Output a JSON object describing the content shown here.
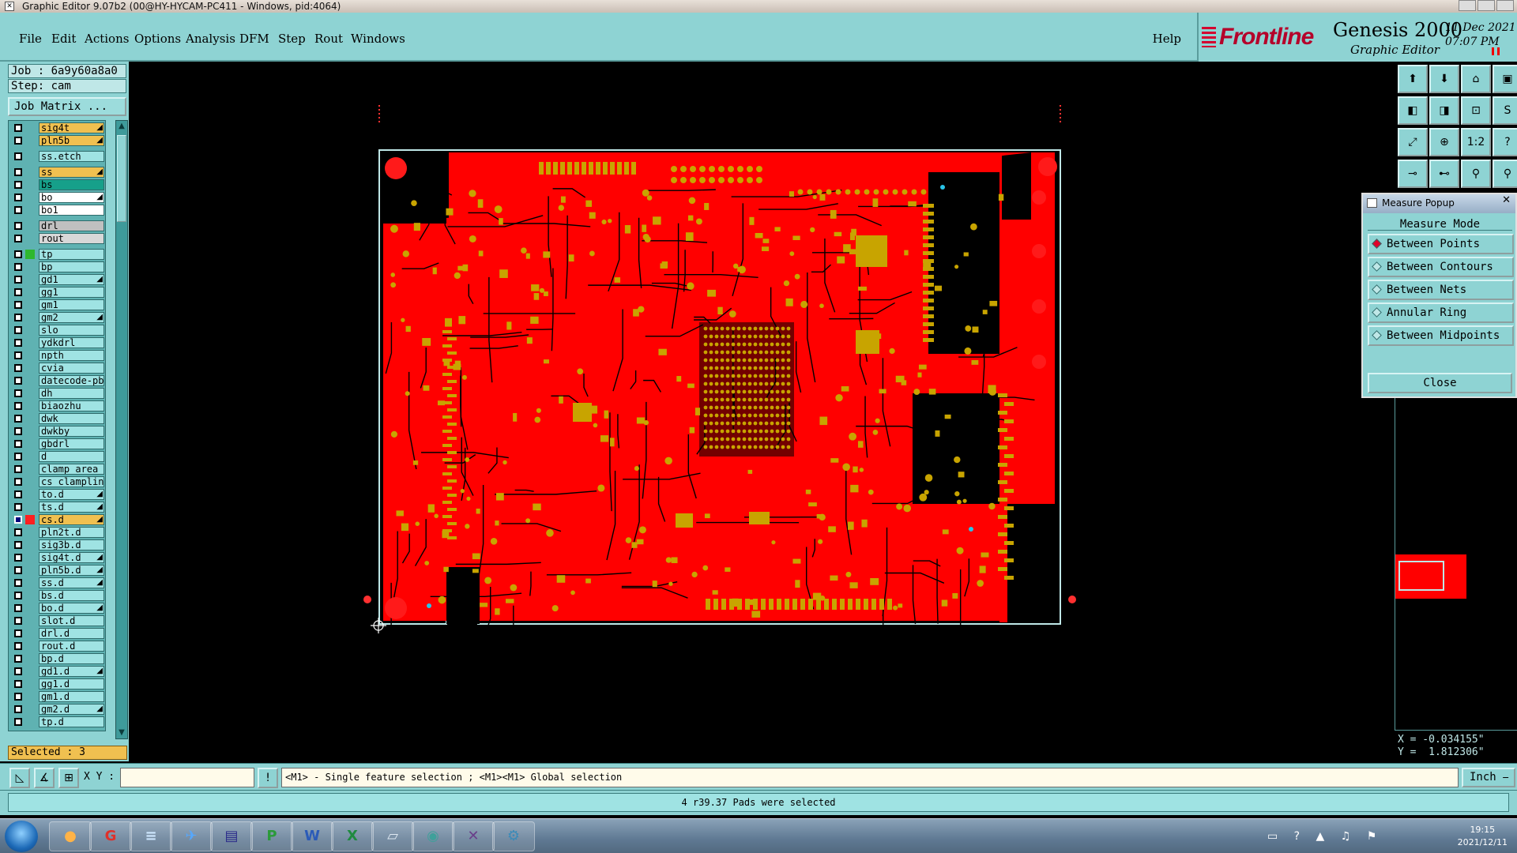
{
  "window": {
    "title": "Graphic Editor 9.07b2 (00@HY-HYCAM-PC411 - Windows, pid:4064)"
  },
  "menu": {
    "items": [
      "File",
      "Edit",
      "Actions",
      "Options",
      "Analysis",
      "DFM",
      "Step",
      "Rout",
      "Windows"
    ],
    "help": "Help"
  },
  "brand": {
    "logo": "Frontline",
    "product": "Genesis 2000",
    "subtitle": "Graphic Editor",
    "date": "11 Dec 2021",
    "time": "07:07 PM"
  },
  "left": {
    "job": "Job : 6a9y60a8a0",
    "step": "Step: cam",
    "job_matrix": "Job Matrix ...",
    "selected": "Selected : 3",
    "layers": [
      {
        "name": "sig4t",
        "color": "#f0c050",
        "flag": "◢"
      },
      {
        "name": "pln5b",
        "color": "#f0c050",
        "flag": "◢"
      },
      {
        "name": "ss.etch",
        "color": "#9fe3e3",
        "flag": ""
      },
      {
        "name": "ss",
        "color": "#f0c050",
        "flag": "◢"
      },
      {
        "name": "bs",
        "color": "#16a08a",
        "flag": ""
      },
      {
        "name": "bo",
        "color": "#ffffff",
        "flag": "◢"
      },
      {
        "name": "bo1",
        "color": "#ffffff",
        "flag": ""
      },
      {
        "name": "drl",
        "color": "#c0c0c0",
        "flag": ""
      },
      {
        "name": "rout",
        "color": "#d8d8d8",
        "flag": ""
      },
      {
        "name": "tp",
        "color": "#9fe3e3",
        "flag": ""
      },
      {
        "name": "bp",
        "color": "#9fe3e3",
        "flag": ""
      },
      {
        "name": "gd1",
        "color": "#9fe3e3",
        "flag": "◢"
      },
      {
        "name": "gg1",
        "color": "#9fe3e3",
        "flag": ""
      },
      {
        "name": "gm1",
        "color": "#9fe3e3",
        "flag": ""
      },
      {
        "name": "gm2",
        "color": "#9fe3e3",
        "flag": "◢"
      },
      {
        "name": "slo",
        "color": "#9fe3e3",
        "flag": ""
      },
      {
        "name": "ydkdrl",
        "color": "#9fe3e3",
        "flag": ""
      },
      {
        "name": "npth",
        "color": "#9fe3e3",
        "flag": ""
      },
      {
        "name": "cvia",
        "color": "#9fe3e3",
        "flag": ""
      },
      {
        "name": "datecode-pbe",
        "color": "#9fe3e3",
        "flag": ""
      },
      {
        "name": "dh",
        "color": "#9fe3e3",
        "flag": ""
      },
      {
        "name": "biaozhu",
        "color": "#9fe3e3",
        "flag": ""
      },
      {
        "name": "dwk",
        "color": "#9fe3e3",
        "flag": ""
      },
      {
        "name": "dwkby",
        "color": "#9fe3e3",
        "flag": ""
      },
      {
        "name": "gbdrl",
        "color": "#9fe3e3",
        "flag": ""
      },
      {
        "name": "d",
        "color": "#9fe3e3",
        "flag": ""
      },
      {
        "name": "clamp_area",
        "color": "#9fe3e3",
        "flag": ""
      },
      {
        "name": "cs_clampline",
        "color": "#9fe3e3",
        "flag": ""
      },
      {
        "name": "to.d",
        "color": "#9fe3e3",
        "flag": "◢"
      },
      {
        "name": "ts.d",
        "color": "#9fe3e3",
        "flag": "◢"
      },
      {
        "name": "cs.d",
        "color": "#f0c050",
        "flag": "◢",
        "active": true
      },
      {
        "name": "pln2t.d",
        "color": "#9fe3e3",
        "flag": ""
      },
      {
        "name": "sig3b.d",
        "color": "#9fe3e3",
        "flag": ""
      },
      {
        "name": "sig4t.d",
        "color": "#9fe3e3",
        "flag": "◢"
      },
      {
        "name": "pln5b.d",
        "color": "#9fe3e3",
        "flag": "◢"
      },
      {
        "name": "ss.d",
        "color": "#9fe3e3",
        "flag": "◢"
      },
      {
        "name": "bs.d",
        "color": "#9fe3e3",
        "flag": ""
      },
      {
        "name": "bo.d",
        "color": "#9fe3e3",
        "flag": "◢"
      },
      {
        "name": "slot.d",
        "color": "#9fe3e3",
        "flag": ""
      },
      {
        "name": "drl.d",
        "color": "#9fe3e3",
        "flag": ""
      },
      {
        "name": "rout.d",
        "color": "#9fe3e3",
        "flag": ""
      },
      {
        "name": "bp.d",
        "color": "#9fe3e3",
        "flag": ""
      },
      {
        "name": "gd1.d",
        "color": "#9fe3e3",
        "flag": "◢"
      },
      {
        "name": "gg1.d",
        "color": "#9fe3e3",
        "flag": ""
      },
      {
        "name": "gm1.d",
        "color": "#9fe3e3",
        "flag": ""
      },
      {
        "name": "gm2.d",
        "color": "#9fe3e3",
        "flag": "◢"
      },
      {
        "name": "tp.d",
        "color": "#9fe3e3",
        "flag": ""
      }
    ]
  },
  "toolbar": {
    "buttons": [
      {
        "icon": "layer-up-icon",
        "glyph": "⬆"
      },
      {
        "icon": "layer-down-icon",
        "glyph": "⬇"
      },
      {
        "icon": "home-icon",
        "glyph": "⌂"
      },
      {
        "icon": "window-icon",
        "glyph": "▣"
      },
      {
        "icon": "pan-left-icon",
        "glyph": "◧"
      },
      {
        "icon": "pan-right-icon",
        "glyph": "◨"
      },
      {
        "icon": "zoom-box-icon",
        "glyph": "⊡"
      },
      {
        "icon": "snap-icon",
        "glyph": "S"
      },
      {
        "icon": "zoom-fit-icon",
        "glyph": "⤢"
      },
      {
        "icon": "zoom-center-icon",
        "glyph": "⊕"
      },
      {
        "icon": "scale-icon",
        "glyph": "1:2"
      },
      {
        "icon": "help-icon",
        "glyph": "?"
      },
      {
        "icon": "measure-icon",
        "glyph": "⊸"
      },
      {
        "icon": "probe-icon",
        "glyph": "⊷"
      },
      {
        "icon": "highlight-net-icon",
        "glyph": "⚲"
      },
      {
        "icon": "net-select-icon",
        "glyph": "⚲"
      }
    ]
  },
  "measure_popup": {
    "title": "Measure Popup",
    "mode_label": "Measure Mode",
    "options": [
      {
        "label": "Between Points",
        "selected": true
      },
      {
        "label": "Between Contours",
        "selected": false
      },
      {
        "label": "Between Nets",
        "selected": false
      },
      {
        "label": "Annular Ring",
        "selected": false
      },
      {
        "label": "Between Midpoints",
        "selected": false
      }
    ],
    "close_label": "Close"
  },
  "coords": {
    "x": "X = -0.034155\"",
    "y": "Y =  1.812306\""
  },
  "inputbar": {
    "xy_label": "X Y :",
    "xy_value": "",
    "hint": "<M1> - Single feature selection ; <M1><M1> Global selection",
    "unit": "Inch ⎯"
  },
  "status": {
    "message": "4 r39.37 Pads were selected"
  },
  "taskbar": {
    "time": "19:15",
    "date": "2021/12/11",
    "apps": [
      "firefox-icon",
      "g-app-icon",
      "notepad-icon",
      "messenger-icon",
      "save-disk-icon",
      "p-app-icon",
      "word-icon",
      "excel-icon",
      "viewer-icon",
      "cam-app-icon",
      "x-app-icon",
      "tool-app-icon"
    ]
  },
  "colors": {
    "copper": "#ff0000",
    "pad": "#c8a400",
    "panel": "#8ed3d3"
  }
}
